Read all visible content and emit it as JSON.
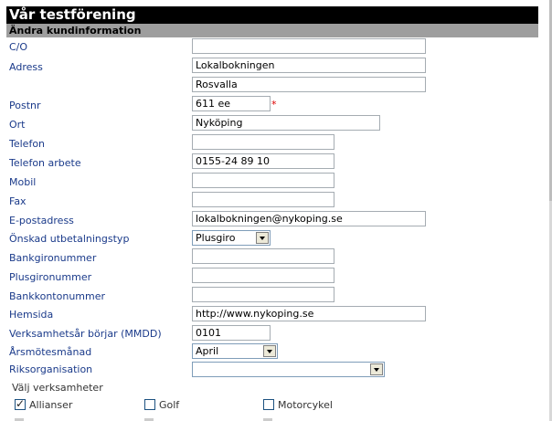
{
  "header": {
    "title": "Vår testförening",
    "section": "Ändra kundinformation"
  },
  "fields": {
    "co": {
      "label": "C/O",
      "value": ""
    },
    "adress": {
      "label": "Adress",
      "value1": "Lokalbokningen",
      "value2": "Rosvalla"
    },
    "postnr": {
      "label": "Postnr",
      "value": "611 ee",
      "required_mark": "*"
    },
    "ort": {
      "label": "Ort",
      "value": "Nyköping"
    },
    "telefon": {
      "label": "Telefon",
      "value": ""
    },
    "telefon_arbete": {
      "label": "Telefon arbete",
      "value": "0155-24 89 10"
    },
    "mobil": {
      "label": "Mobil",
      "value": ""
    },
    "fax": {
      "label": "Fax",
      "value": ""
    },
    "epost": {
      "label": "E-postadress",
      "value": "lokalbokningen@nykoping.se"
    },
    "utbetalningstyp": {
      "label": "Önskad utbetalningstyp",
      "value": "Plusgiro"
    },
    "bankgiro": {
      "label": "Bankgironummer",
      "value": ""
    },
    "plusgiro": {
      "label": "Plusgironummer",
      "value": ""
    },
    "bankkonto": {
      "label": "Bankkontonummer",
      "value": ""
    },
    "hemsida": {
      "label": "Hemsida",
      "value": "http://www.nykoping.se"
    },
    "verksamhetsar": {
      "label": "Verksamhetsår börjar (MMDD)",
      "value": "0101"
    },
    "arsmotesmanad": {
      "label": "Årsmötesmånad",
      "value": "April"
    },
    "riksorganisation": {
      "label": "Riksorganisation",
      "value": ""
    }
  },
  "verksamheter": {
    "label": "Välj verksamheter",
    "options": [
      {
        "label": "Allianser",
        "checked": true
      },
      {
        "label": "Golf",
        "checked": false
      },
      {
        "label": "Motorcykel",
        "checked": false
      }
    ]
  }
}
